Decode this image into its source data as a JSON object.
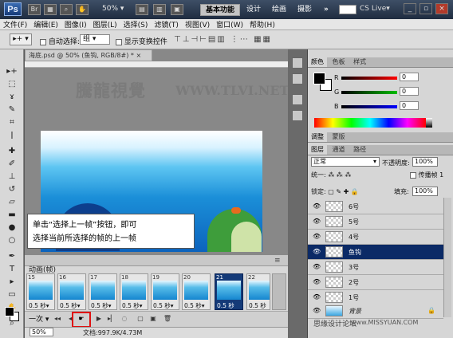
{
  "app": {
    "logo": "Ps",
    "zoom": "50%"
  },
  "titlebar": {
    "workspaces": [
      "基本功能",
      "设计",
      "绘画",
      "摄影"
    ],
    "more": "»",
    "cslive": "CS Live▾"
  },
  "menu": [
    "文件(F)",
    "编辑(E)",
    "图像(I)",
    "图层(L)",
    "选择(S)",
    "滤镜(T)",
    "视图(V)",
    "窗口(W)",
    "帮助(H)"
  ],
  "options": {
    "auto_select": "自动选择:",
    "group": "组",
    "show_transform": "显示变换控件"
  },
  "document": {
    "tab": "海底.psd @ 50% (鱼钩, RGB/8#) *",
    "tab_close": "×",
    "zoom": "50%",
    "size": "文档:997.9K/4.73M"
  },
  "watermark": {
    "cn": "騰龍視覺",
    "url": "WWW.TLVI.NET"
  },
  "callout": {
    "line1": "单击“选择上一帧”按钮，即可",
    "line2": "选择当前所选择的帧的上一帧"
  },
  "animation": {
    "title": "动画(帧)",
    "frames": [
      {
        "num": "15",
        "dur": "0.5 秒▾"
      },
      {
        "num": "16",
        "dur": "0.5 秒▾"
      },
      {
        "num": "17",
        "dur": "0.5 秒▾"
      },
      {
        "num": "18",
        "dur": "0.5 秒▾"
      },
      {
        "num": "19",
        "dur": "0.5 秒▾"
      },
      {
        "num": "20",
        "dur": "0.5 秒▾"
      },
      {
        "num": "21",
        "dur": "0.5 秒"
      },
      {
        "num": "22",
        "dur": "0.5 秒"
      }
    ],
    "selected_frame": "21",
    "loop": "一次"
  },
  "panels": {
    "color_tabs": [
      "颜色",
      "色板",
      "样式"
    ],
    "color": {
      "R": "R",
      "G": "G",
      "B": "B",
      "r_val": "0",
      "g_val": "0",
      "b_val": "0"
    },
    "adjust_tabs": [
      "调整",
      "蒙版"
    ],
    "layer_tabs": [
      "图层",
      "通道",
      "路径"
    ],
    "blend_mode": "正常",
    "opacity_label": "不透明度:",
    "opacity": "100%",
    "unify": "统一:",
    "propagate": "传播帧 1",
    "lock": "锁定:",
    "fill_label": "填充:",
    "fill": "100%",
    "layers": [
      "6号",
      "5号",
      "4号",
      "鱼钩",
      "3号",
      "2号",
      "1号",
      "背景"
    ],
    "selected_layer": "鱼钩"
  },
  "site": {
    "wm": "思缘设计论坛",
    "url": "www.MISSYUAN.COM"
  },
  "colors": {
    "selection": "#143a78",
    "highlight": "#e01010",
    "titlebar": "#1f2c40"
  }
}
